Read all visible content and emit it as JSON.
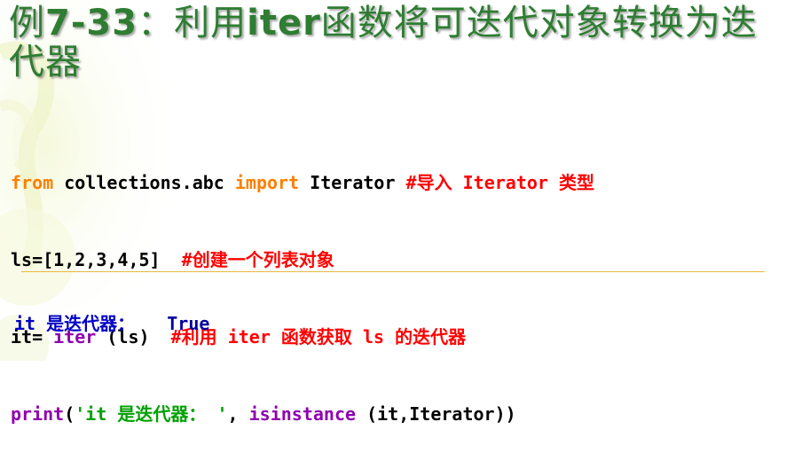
{
  "slide": {
    "title_prefix": "例",
    "title_number": "7-33",
    "title_sep": "：利用",
    "title_iter": "iter",
    "title_rest": "函数将可迭代对象转换为迭代器"
  },
  "code": {
    "line1": {
      "kw_from": "from",
      "module": " collections.abc ",
      "kw_import": "import",
      "name": " Iterator ",
      "comment": "#导入 Iterator 类型"
    },
    "line2": {
      "code": "ls=[1,2,3,4,5]  ",
      "comment": "#创建一个列表对象"
    },
    "line3": {
      "lhs": "it= ",
      "fn": "iter",
      "args": " (ls)  ",
      "comment": "#利用 iter 函数获取 ls 的迭代器"
    },
    "line4": {
      "fn_print": "print",
      "paren_open": "(",
      "string": "'it 是迭代器： '",
      "comma": ", ",
      "fn_isinstance": "isinstance",
      "args": " (it,Iterator))"
    }
  },
  "output": {
    "label": "it 是迭代器：",
    "value": "True"
  },
  "colors": {
    "title": "#2e7d32",
    "keyword": "#ff7f00",
    "comment": "#ff0000",
    "builtin": "#9000b0",
    "string": "#00a000",
    "output": "#0000c8",
    "divider": "#e8b840"
  }
}
